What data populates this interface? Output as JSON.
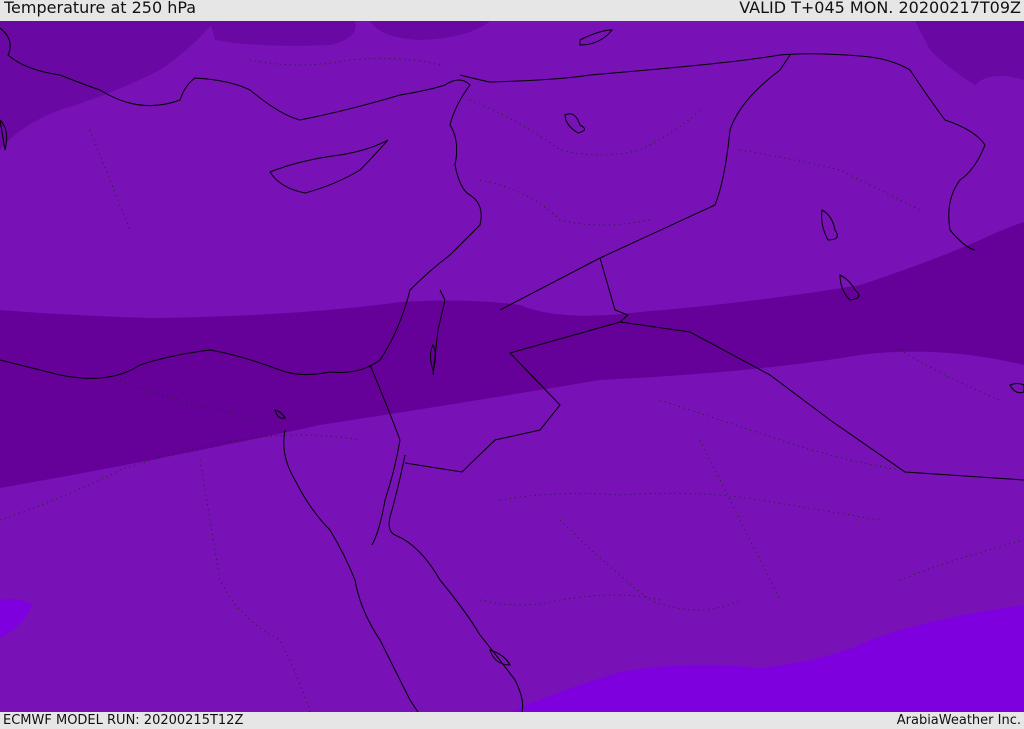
{
  "header": {
    "title": "Temperature at 250 hPa",
    "valid": "VALID T+045 MON. 20200217T09Z"
  },
  "footer": {
    "model_run": "ECMWF MODEL RUN: 20200215T12Z",
    "credit": "ArabiaWeather Inc."
  },
  "colors": {
    "base_field": "#7812b6",
    "cold_band": "#650199",
    "cold_patch": "#6a08a4",
    "warm_field": "#7e00de",
    "coastline": "#000000"
  }
}
